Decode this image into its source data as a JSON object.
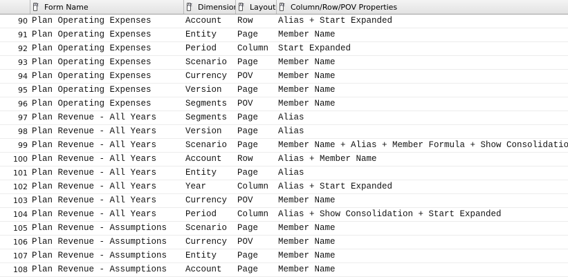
{
  "columns": [
    "",
    "Form Name",
    "Dimension",
    "Layout",
    "Column/Row/POV Properties"
  ],
  "rows": [
    [
      "90",
      "Plan Operating Expenses",
      "Account",
      "Row",
      "Alias + Start Expanded"
    ],
    [
      "91",
      "Plan Operating Expenses",
      "Entity",
      "Page",
      "Member Name"
    ],
    [
      "92",
      "Plan Operating Expenses",
      "Period",
      "Column",
      "Start Expanded"
    ],
    [
      "93",
      "Plan Operating Expenses",
      "Scenario",
      "Page",
      "Member Name"
    ],
    [
      "94",
      "Plan Operating Expenses",
      "Currency",
      "POV",
      "Member Name"
    ],
    [
      "95",
      "Plan Operating Expenses",
      "Version",
      "Page",
      "Member Name"
    ],
    [
      "96",
      "Plan Operating Expenses",
      "Segments",
      "POV",
      "Member Name"
    ],
    [
      "97",
      "Plan Revenue - All Years",
      "Segments",
      "Page",
      "Alias"
    ],
    [
      "98",
      "Plan Revenue - All Years",
      "Version",
      "Page",
      "Alias"
    ],
    [
      "99",
      "Plan Revenue - All Years",
      "Scenario",
      "Page",
      "Member Name + Alias + Member Formula + Show Consolidation"
    ],
    [
      "100",
      "Plan Revenue - All Years",
      "Account",
      "Row",
      "Alias + Member Name"
    ],
    [
      "101",
      "Plan Revenue - All Years",
      "Entity",
      "Page",
      "Alias"
    ],
    [
      "102",
      "Plan Revenue - All Years",
      "Year",
      "Column",
      "Alias + Start Expanded"
    ],
    [
      "103",
      "Plan Revenue - All Years",
      "Currency",
      "POV",
      "Member Name"
    ],
    [
      "104",
      "Plan Revenue - All Years",
      "Period",
      "Column",
      "Alias + Show Consolidation + Start Expanded"
    ],
    [
      "105",
      "Plan Revenue - Assumptions",
      "Scenario",
      "Page",
      "Member Name"
    ],
    [
      "106",
      "Plan Revenue - Assumptions",
      "Currency",
      "POV",
      "Member Name"
    ],
    [
      "107",
      "Plan Revenue - Assumptions",
      "Entity",
      "Page",
      "Member Name"
    ],
    [
      "108",
      "Plan Revenue - Assumptions",
      "Account",
      "Page",
      "Member Name"
    ]
  ]
}
